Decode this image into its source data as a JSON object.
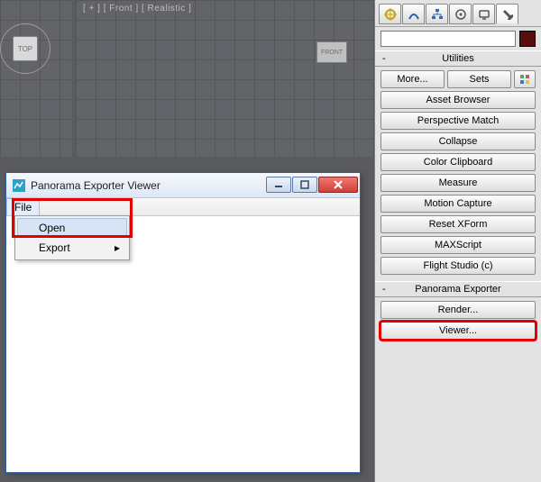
{
  "viewport": {
    "top_cube": "TOP",
    "front_cube": "FRONT",
    "front_label": "[ + ]   [ Front ]   [ Realistic ]"
  },
  "panel": {
    "utilities_title": "Utilities",
    "more": "More...",
    "sets": "Sets",
    "buttons": [
      "Asset Browser",
      "Perspective Match",
      "Collapse",
      "Color Clipboard",
      "Measure",
      "Motion Capture",
      "Reset XForm",
      "MAXScript",
      "Flight Studio (c)"
    ],
    "pano_title": "Panorama Exporter",
    "render": "Render...",
    "viewer": "Viewer..."
  },
  "popup": {
    "title": "Panorama Exporter Viewer",
    "menu_file": "File",
    "menu_open": "Open",
    "menu_export": "Export"
  }
}
